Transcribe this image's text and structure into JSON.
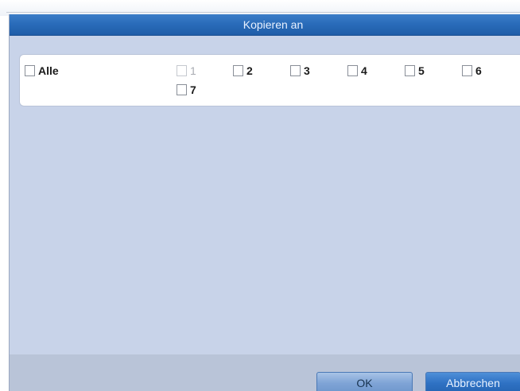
{
  "dialog": {
    "title": "Kopieren an",
    "all_label": "Alle",
    "channels": [
      {
        "label": "1",
        "disabled": true
      },
      {
        "label": "2",
        "disabled": false
      },
      {
        "label": "3",
        "disabled": false
      },
      {
        "label": "4",
        "disabled": false
      },
      {
        "label": "5",
        "disabled": false
      },
      {
        "label": "6",
        "disabled": false
      },
      {
        "label": "7",
        "disabled": false
      }
    ],
    "ok_label": "OK",
    "cancel_label": "Abbrechen"
  },
  "colors": {
    "titlebar": "#2a6cba",
    "dialog_bg": "#c8d3e9",
    "footer_bg": "#b9c4d8",
    "ok_button": "#7fa4d6",
    "cancel_button": "#2f72c4"
  }
}
